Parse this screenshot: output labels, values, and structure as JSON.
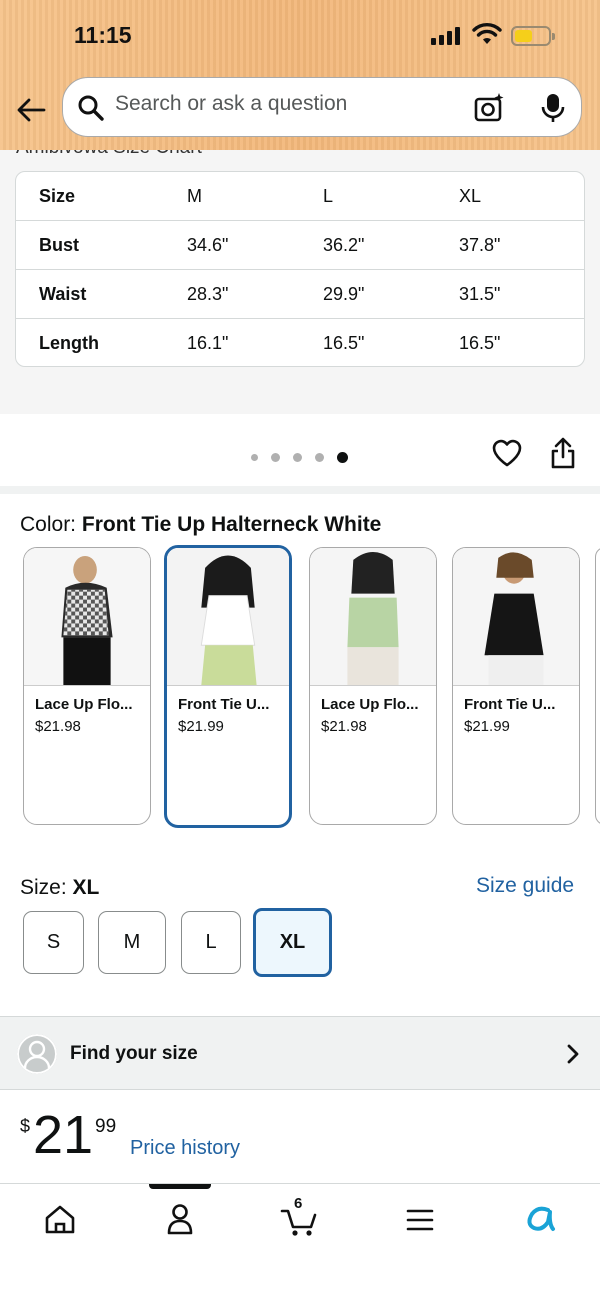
{
  "status_bar": {
    "time": "11:15"
  },
  "search": {
    "placeholder": "Search or ask a question"
  },
  "size_chart": {
    "caption": "Amiblvowa Size Chart",
    "headers": [
      "Size",
      "M",
      "L",
      "XL"
    ],
    "rows": [
      {
        "label": "Bust",
        "values": [
          "34.6\"",
          "36.2\"",
          "37.8\""
        ]
      },
      {
        "label": "Waist",
        "values": [
          "28.3\"",
          "29.9\"",
          "31.5\""
        ]
      },
      {
        "label": "Length",
        "values": [
          "16.1\"",
          "16.5\"",
          "16.5\""
        ]
      }
    ]
  },
  "image_carousel": {
    "total": 5,
    "active_index": 4
  },
  "color": {
    "label": "Color:",
    "selected": "Front Tie Up Halterneck White",
    "variants": [
      {
        "name": "Lace Up Flo...",
        "price": "$21.98",
        "selected": false
      },
      {
        "name": "Front Tie U...",
        "price": "$21.99",
        "selected": true
      },
      {
        "name": "Lace Up Flo...",
        "price": "$21.98",
        "selected": false
      },
      {
        "name": "Front Tie U...",
        "price": "$21.99",
        "selected": false
      }
    ]
  },
  "size": {
    "label": "Size:",
    "selected": "XL",
    "guide_link": "Size guide",
    "options": [
      "S",
      "M",
      "L",
      "XL"
    ]
  },
  "find_size": {
    "label": "Find your size"
  },
  "price": {
    "currency": "$",
    "whole": "21",
    "fraction": "99",
    "history_link": "Price history"
  },
  "bottom_nav": {
    "cart_count": "6"
  },
  "colors": {
    "accent": "#2162a1",
    "header": "#f2b77a",
    "selected_bg": "#edf7fd"
  }
}
